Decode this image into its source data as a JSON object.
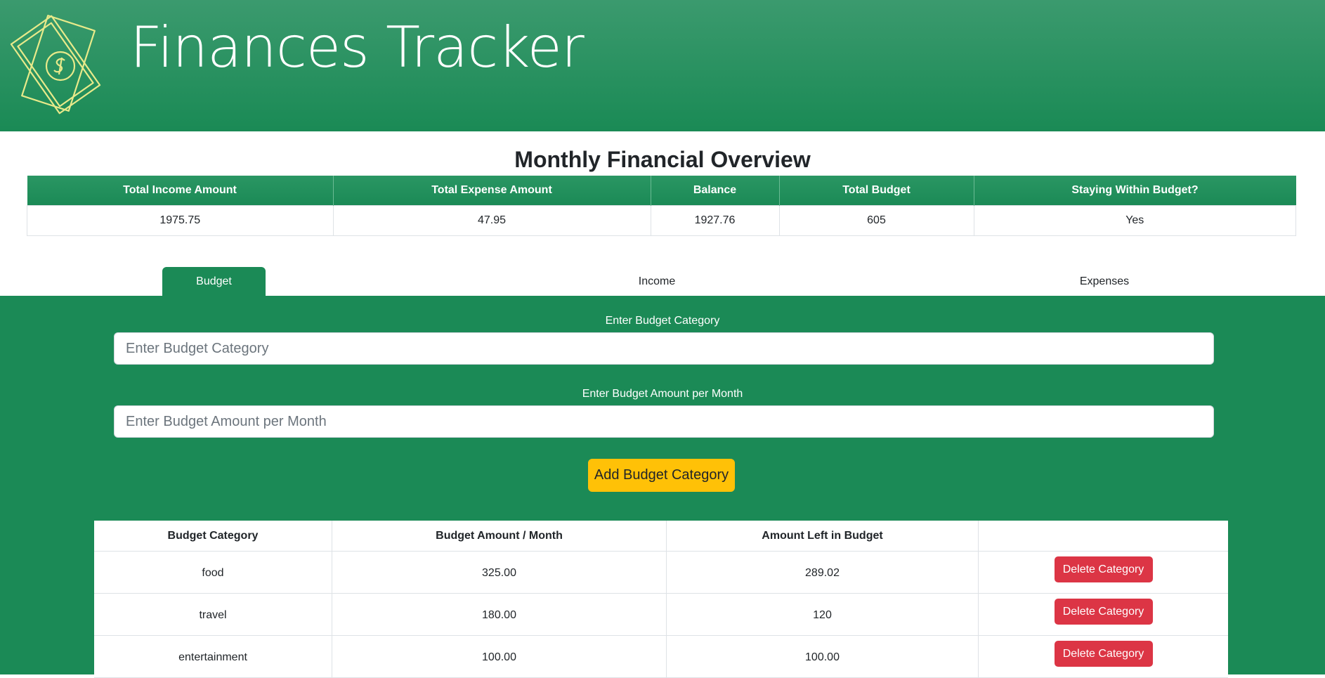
{
  "header": {
    "title": "Finances Tracker",
    "logo_icon": "money-bills-icon"
  },
  "overview": {
    "title": "Monthly Financial Overview",
    "columns": [
      "Total Income Amount",
      "Total Expense Amount",
      "Balance",
      "Total Budget",
      "Staying Within Budget?"
    ],
    "values": [
      "1975.75",
      "47.95",
      "1927.76",
      "605",
      "Yes"
    ]
  },
  "tabs": [
    {
      "label": "Budget",
      "active": true
    },
    {
      "label": "Income",
      "active": false
    },
    {
      "label": "Expenses",
      "active": false
    }
  ],
  "budget_form": {
    "category_label": "Enter Budget Category",
    "category_placeholder": "Enter Budget Category",
    "category_value": "",
    "amount_label": "Enter Budget Amount per Month",
    "amount_placeholder": "Enter Budget Amount per Month",
    "amount_value": "",
    "add_button": "Add Budget Category"
  },
  "budget_table": {
    "columns": [
      "Budget Category",
      "Budget Amount / Month",
      "Amount Left in Budget",
      ""
    ],
    "rows": [
      {
        "category": "food",
        "amount": "325.00",
        "left": "289.02",
        "action": "Delete Category"
      },
      {
        "category": "travel",
        "amount": "180.00",
        "left": "120",
        "action": "Delete Category"
      },
      {
        "category": "entertainment",
        "amount": "100.00",
        "left": "100.00",
        "action": "Delete Category"
      }
    ]
  },
  "colors": {
    "primary_green": "#1b8a56",
    "header_green_light": "#3b9a6e",
    "warning_yellow": "#ffc107",
    "danger_red": "#dc3545",
    "logo_yellow": "#e8ea8a"
  }
}
